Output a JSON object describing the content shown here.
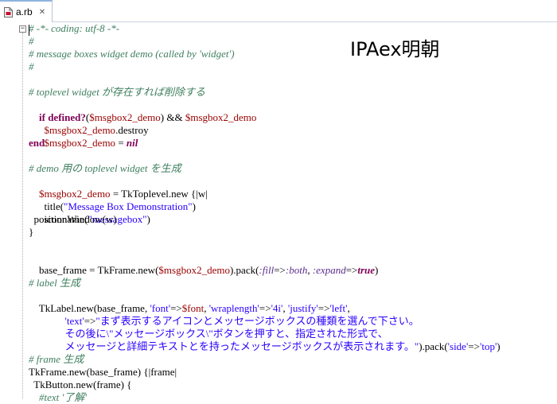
{
  "tab": {
    "label": "a.rb",
    "close": "✕"
  },
  "overlay_text": "IPAex明朝",
  "code": {
    "l01": "# -*- coding: utf-8 -*-",
    "l02": "#",
    "l03": "# message boxes widget demo (called by 'widget')",
    "l04": "#",
    "l06": "# toplevel widget が存在すれば削除する",
    "l07": [
      "if",
      " ",
      "defined?",
      "(",
      "$msgbox2_demo",
      ") && ",
      "$msgbox2_demo"
    ],
    "l08": [
      "  ",
      "$msgbox2_demo",
      ".destroy"
    ],
    "l09": [
      "  ",
      "$msgbox2_demo",
      " = ",
      "nil"
    ],
    "l10": "end",
    "l12": "# demo 用の toplevel widget を生成",
    "l13": [
      "$msgbox2_demo",
      " = TkToplevel.new {|w|"
    ],
    "l14": [
      "  title(",
      "\"Message Box Demonstration\"",
      ")"
    ],
    "l15": [
      "  iconname(",
      "\"messagebox\"",
      ")"
    ],
    "l16": "  positionWindow(w)",
    "l17": "}",
    "l19": [
      "base_frame = TkFrame.new(",
      "$msgbox2_demo",
      ").pack(",
      ":fill",
      "=>",
      ":both",
      ", ",
      ":expand",
      "=>",
      "true",
      ")"
    ],
    "l21": "# label 生成",
    "l22": [
      "TkLabel.new(base_frame, ",
      "'font'",
      "=>",
      "$font",
      ", ",
      "'wraplength'",
      "=>",
      "'4i'",
      ", ",
      "'justify'",
      "=>",
      "'left'",
      ","
    ],
    "l23": [
      "          ",
      "'text'",
      "=>",
      "\"まず表示するアイコンとメッセージボックスの種類を選んで下さい。"
    ],
    "l24": [
      "          ",
      "その後に\\\"メッセージボックス\\\"ボタンを押すと、指定された形式で、"
    ],
    "l25": [
      "          ",
      "メッセージと詳細テキストとを持ったメッセージボックスが表示されます。\"",
      ").pack(",
      "'side'",
      "=>",
      "'top'",
      ")"
    ],
    "l27": "# frame 生成",
    "l28": "TkFrame.new(base_frame) {|frame|",
    "l29": "  TkButton.new(frame) {",
    "l30": "    #text '了解'"
  }
}
